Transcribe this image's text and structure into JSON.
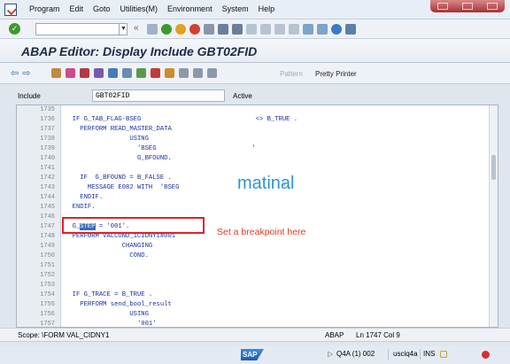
{
  "menu": [
    "Program",
    "Edit",
    "Goto",
    "Utilities(M)",
    "Environment",
    "System",
    "Help"
  ],
  "toolbar": {
    "command_field": "",
    "enter_icon": "check-icon"
  },
  "title": "ABAP Editor: Display Include GBT02FID",
  "app_toolbar": {
    "pattern_label": "Pattern",
    "pretty_printer_label": "Pretty Printer"
  },
  "include": {
    "label": "Include",
    "value": "GBT02FID",
    "status": "Active"
  },
  "editor": {
    "lines": [
      {
        "no": "1735",
        "text": ""
      },
      {
        "no": "1736",
        "text": "  IF G_TAB_FLAG-BSEG                              <> B_TRUE ."
      },
      {
        "no": "1737",
        "text": "    PERFORM READ_MASTER_DATA"
      },
      {
        "no": "1738",
        "text": "                 USING"
      },
      {
        "no": "1739",
        "text": "                   'BSEG                         '"
      },
      {
        "no": "1740",
        "text": "                   G_BFOUND."
      },
      {
        "no": "1741",
        "text": ""
      },
      {
        "no": "1742",
        "text": "    IF  G_BFOUND = B_FALSE ."
      },
      {
        "no": "1743",
        "text": "      MESSAGE E082 WITH  'BSEG                           '."
      },
      {
        "no": "1744",
        "text": "    ENDIF."
      },
      {
        "no": "1745",
        "text": "  ENDIF."
      },
      {
        "no": "1746",
        "text": ""
      },
      {
        "no": "1747",
        "text": "  G_STEP = '001'."
      },
      {
        "no": "1748",
        "text": "  PERFORM VALCOND_1CIDNY1#001"
      },
      {
        "no": "1749",
        "text": "               CHANGING"
      },
      {
        "no": "1750",
        "text": "                 COND."
      },
      {
        "no": "1751",
        "text": ""
      },
      {
        "no": "1752",
        "text": ""
      },
      {
        "no": "1753",
        "text": ""
      },
      {
        "no": "1754",
        "text": "  IF G_TRACE = B_TRUE ."
      },
      {
        "no": "1755",
        "text": "    PERFORM send_bool_result"
      },
      {
        "no": "1756",
        "text": "                 USING"
      },
      {
        "no": "1757",
        "text": "                   '001'"
      }
    ]
  },
  "annotations": {
    "watermark": "matinal",
    "breakpoint_note": "Set a breakpoint here"
  },
  "scope": {
    "label": "Scope: \\FORM VAL_CIDNY1",
    "language": "ABAP",
    "position": "Ln 1747 Col  9"
  },
  "status_bar": {
    "logo": "SAP",
    "system": "Q4A (1) 002",
    "host": "usciq4a",
    "mode": "INS"
  }
}
